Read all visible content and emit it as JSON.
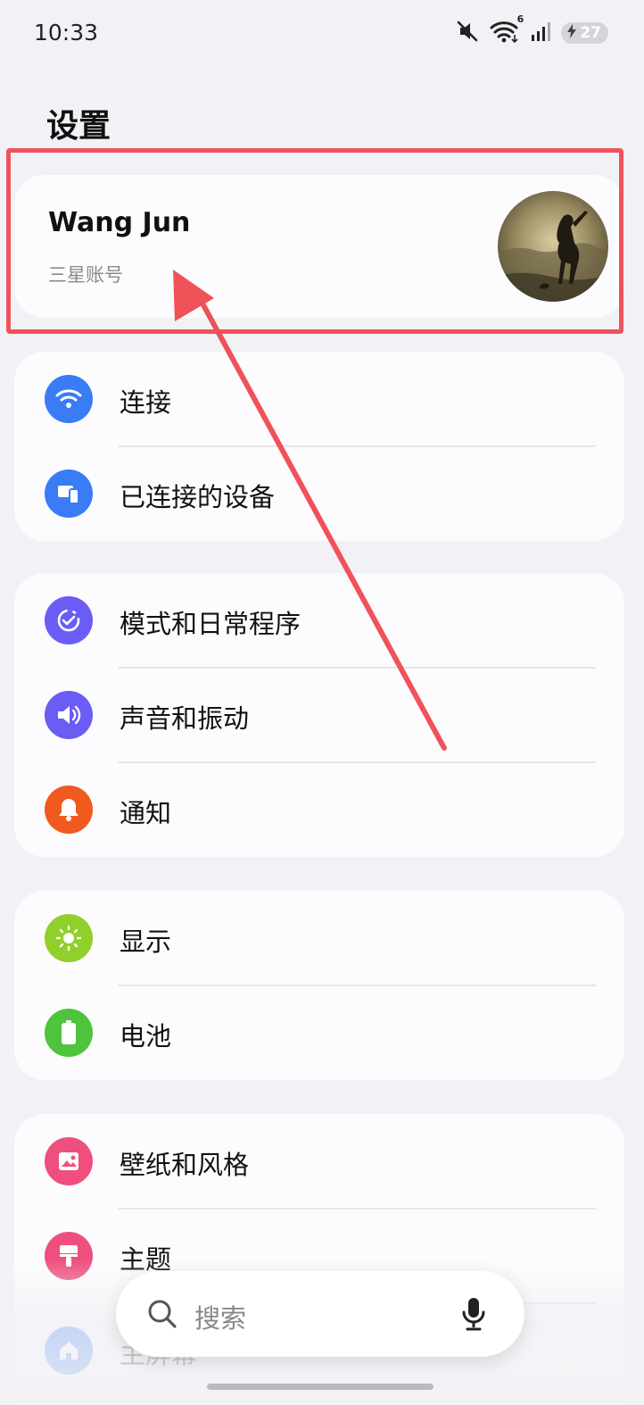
{
  "status_bar": {
    "time": "10:33",
    "battery_level": "27",
    "icons": [
      "mute-icon",
      "wifi-icon",
      "signal-icon",
      "battery-charging-icon"
    ],
    "wifi_badge": "6"
  },
  "page": {
    "title": "设置"
  },
  "account": {
    "name": "Wang Jun",
    "subtitle": "三星账号"
  },
  "groups": [
    {
      "items": [
        {
          "label": "连接",
          "icon": "wifi-icon",
          "color": "#3a7bf6"
        },
        {
          "label": "已连接的设备",
          "icon": "devices-icon",
          "color": "#3a7bf6"
        }
      ]
    },
    {
      "items": [
        {
          "label": "模式和日常程序",
          "icon": "modes-icon",
          "color": "#6b5cf5"
        },
        {
          "label": "声音和振动",
          "icon": "speaker-icon",
          "color": "#6b5cf5"
        },
        {
          "label": "通知",
          "icon": "bell-icon",
          "color": "#f05a1e"
        }
      ]
    },
    {
      "items": [
        {
          "label": "显示",
          "icon": "sun-icon",
          "color": "#8fd02a"
        },
        {
          "label": "电池",
          "icon": "battery-icon",
          "color": "#4ec43c"
        }
      ]
    },
    {
      "items": [
        {
          "label": "壁纸和风格",
          "icon": "wallpaper-icon",
          "color": "#ee4f7c"
        },
        {
          "label": "主题",
          "icon": "theme-icon",
          "color": "#ee4f7c"
        },
        {
          "label": "主屏幕",
          "icon": "home-icon",
          "color": "#3a7bf6"
        }
      ]
    }
  ],
  "search": {
    "placeholder": "搜索"
  },
  "annotation": {
    "color": "#f0525a"
  }
}
